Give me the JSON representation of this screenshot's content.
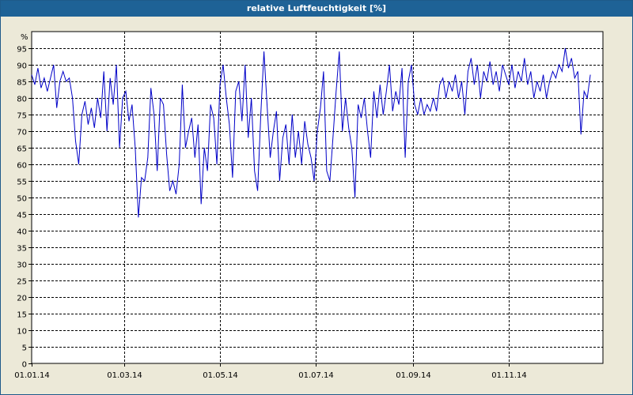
{
  "window": {
    "title": "relative Luftfeuchtigkeit [%]"
  },
  "chart_data": {
    "type": "line",
    "title": "relative Luftfeuchtigkeit [%]",
    "ylabel": "%",
    "xlabel": "",
    "ylim": [
      0,
      100
    ],
    "xlim": [
      "2014-01-01",
      "2014-12-31"
    ],
    "grid": true,
    "yticks": [
      0,
      5,
      10,
      15,
      20,
      25,
      30,
      35,
      40,
      45,
      50,
      55,
      60,
      65,
      70,
      75,
      80,
      85,
      90,
      95
    ],
    "xticks": [
      {
        "date": "2014-01-01",
        "label": "01.01.14"
      },
      {
        "date": "2014-03-01",
        "label": "01.03.14"
      },
      {
        "date": "2014-05-01",
        "label": "01.05.14"
      },
      {
        "date": "2014-07-01",
        "label": "01.07.14"
      },
      {
        "date": "2014-09-01",
        "label": "01.09.14"
      },
      {
        "date": "2014-11-01",
        "label": "01.11.14"
      }
    ],
    "series": [
      {
        "color": "#0000c8",
        "points": [
          [
            "2014-01-01",
            87
          ],
          [
            "2014-01-03",
            84
          ],
          [
            "2014-01-05",
            89
          ],
          [
            "2014-01-07",
            83
          ],
          [
            "2014-01-09",
            86
          ],
          [
            "2014-01-11",
            82
          ],
          [
            "2014-01-13",
            86
          ],
          [
            "2014-01-15",
            90
          ],
          [
            "2014-01-17",
            77
          ],
          [
            "2014-01-19",
            85
          ],
          [
            "2014-01-21",
            88
          ],
          [
            "2014-01-23",
            85
          ],
          [
            "2014-01-25",
            86
          ],
          [
            "2014-01-27",
            80
          ],
          [
            "2014-01-29",
            67
          ],
          [
            "2014-01-31",
            60
          ],
          [
            "2014-02-02",
            75
          ],
          [
            "2014-02-04",
            79
          ],
          [
            "2014-02-06",
            72
          ],
          [
            "2014-02-08",
            77
          ],
          [
            "2014-02-10",
            71
          ],
          [
            "2014-02-12",
            80
          ],
          [
            "2014-02-14",
            74
          ],
          [
            "2014-02-16",
            88
          ],
          [
            "2014-02-18",
            70
          ],
          [
            "2014-02-20",
            86
          ],
          [
            "2014-02-22",
            78
          ],
          [
            "2014-02-24",
            90
          ],
          [
            "2014-02-26",
            65
          ],
          [
            "2014-02-28",
            80
          ],
          [
            "2014-03-02",
            82
          ],
          [
            "2014-03-04",
            73
          ],
          [
            "2014-03-06",
            78
          ],
          [
            "2014-03-08",
            65
          ],
          [
            "2014-03-10",
            44
          ],
          [
            "2014-03-12",
            56
          ],
          [
            "2014-03-14",
            55
          ],
          [
            "2014-03-16",
            62
          ],
          [
            "2014-03-18",
            83
          ],
          [
            "2014-03-20",
            75
          ],
          [
            "2014-03-22",
            58
          ],
          [
            "2014-03-24",
            80
          ],
          [
            "2014-03-26",
            78
          ],
          [
            "2014-03-28",
            63
          ],
          [
            "2014-03-30",
            52
          ],
          [
            "2014-04-01",
            55
          ],
          [
            "2014-04-03",
            51
          ],
          [
            "2014-04-05",
            60
          ],
          [
            "2014-04-07",
            84
          ],
          [
            "2014-04-09",
            65
          ],
          [
            "2014-04-11",
            70
          ],
          [
            "2014-04-13",
            74
          ],
          [
            "2014-04-15",
            62
          ],
          [
            "2014-04-17",
            72
          ],
          [
            "2014-04-19",
            48
          ],
          [
            "2014-04-21",
            65
          ],
          [
            "2014-04-23",
            58
          ],
          [
            "2014-04-25",
            78
          ],
          [
            "2014-04-27",
            74
          ],
          [
            "2014-04-29",
            60
          ],
          [
            "2014-05-01",
            84
          ],
          [
            "2014-05-03",
            90
          ],
          [
            "2014-05-05",
            80
          ],
          [
            "2014-05-07",
            72
          ],
          [
            "2014-05-09",
            56
          ],
          [
            "2014-05-11",
            82
          ],
          [
            "2014-05-13",
            85
          ],
          [
            "2014-05-15",
            73
          ],
          [
            "2014-05-17",
            90
          ],
          [
            "2014-05-19",
            68
          ],
          [
            "2014-05-21",
            80
          ],
          [
            "2014-05-23",
            58
          ],
          [
            "2014-05-25",
            52
          ],
          [
            "2014-05-27",
            75
          ],
          [
            "2014-05-29",
            94
          ],
          [
            "2014-05-31",
            78
          ],
          [
            "2014-06-02",
            62
          ],
          [
            "2014-06-04",
            70
          ],
          [
            "2014-06-06",
            76
          ],
          [
            "2014-06-08",
            55
          ],
          [
            "2014-06-10",
            68
          ],
          [
            "2014-06-12",
            72
          ],
          [
            "2014-06-14",
            60
          ],
          [
            "2014-06-16",
            75
          ],
          [
            "2014-06-18",
            62
          ],
          [
            "2014-06-20",
            70
          ],
          [
            "2014-06-22",
            60
          ],
          [
            "2014-06-24",
            73
          ],
          [
            "2014-06-26",
            66
          ],
          [
            "2014-06-28",
            62
          ],
          [
            "2014-06-30",
            55
          ],
          [
            "2014-07-02",
            70
          ],
          [
            "2014-07-04",
            77
          ],
          [
            "2014-07-06",
            88
          ],
          [
            "2014-07-08",
            58
          ],
          [
            "2014-07-10",
            55
          ],
          [
            "2014-07-12",
            68
          ],
          [
            "2014-07-14",
            82
          ],
          [
            "2014-07-16",
            94
          ],
          [
            "2014-07-18",
            70
          ],
          [
            "2014-07-20",
            80
          ],
          [
            "2014-07-22",
            71
          ],
          [
            "2014-07-24",
            65
          ],
          [
            "2014-07-26",
            50
          ],
          [
            "2014-07-28",
            78
          ],
          [
            "2014-07-30",
            74
          ],
          [
            "2014-08-01",
            80
          ],
          [
            "2014-08-03",
            70
          ],
          [
            "2014-08-05",
            62
          ],
          [
            "2014-08-07",
            82
          ],
          [
            "2014-08-09",
            74
          ],
          [
            "2014-08-11",
            84
          ],
          [
            "2014-08-13",
            75
          ],
          [
            "2014-08-15",
            82
          ],
          [
            "2014-08-17",
            90
          ],
          [
            "2014-08-19",
            76
          ],
          [
            "2014-08-21",
            82
          ],
          [
            "2014-08-23",
            78
          ],
          [
            "2014-08-25",
            89
          ],
          [
            "2014-08-27",
            62
          ],
          [
            "2014-08-29",
            85
          ],
          [
            "2014-08-31",
            90
          ],
          [
            "2014-09-02",
            78
          ],
          [
            "2014-09-04",
            75
          ],
          [
            "2014-09-06",
            80
          ],
          [
            "2014-09-08",
            75
          ],
          [
            "2014-09-10",
            78
          ],
          [
            "2014-09-12",
            76
          ],
          [
            "2014-09-14",
            80
          ],
          [
            "2014-09-16",
            76
          ],
          [
            "2014-09-18",
            84
          ],
          [
            "2014-09-20",
            86
          ],
          [
            "2014-09-22",
            80
          ],
          [
            "2014-09-24",
            85
          ],
          [
            "2014-09-26",
            82
          ],
          [
            "2014-09-28",
            87
          ],
          [
            "2014-09-30",
            80
          ],
          [
            "2014-10-02",
            85
          ],
          [
            "2014-10-04",
            75
          ],
          [
            "2014-10-06",
            88
          ],
          [
            "2014-10-08",
            92
          ],
          [
            "2014-10-10",
            84
          ],
          [
            "2014-10-12",
            90
          ],
          [
            "2014-10-14",
            80
          ],
          [
            "2014-10-16",
            88
          ],
          [
            "2014-10-18",
            85
          ],
          [
            "2014-10-20",
            91
          ],
          [
            "2014-10-22",
            84
          ],
          [
            "2014-10-24",
            88
          ],
          [
            "2014-10-26",
            82
          ],
          [
            "2014-10-28",
            90
          ],
          [
            "2014-10-30",
            87
          ],
          [
            "2014-11-01",
            84
          ],
          [
            "2014-11-03",
            90
          ],
          [
            "2014-11-05",
            83
          ],
          [
            "2014-11-07",
            88
          ],
          [
            "2014-11-09",
            85
          ],
          [
            "2014-11-11",
            92
          ],
          [
            "2014-11-13",
            84
          ],
          [
            "2014-11-15",
            88
          ],
          [
            "2014-11-17",
            80
          ],
          [
            "2014-11-19",
            85
          ],
          [
            "2014-11-21",
            82
          ],
          [
            "2014-11-23",
            87
          ],
          [
            "2014-11-25",
            80
          ],
          [
            "2014-11-27",
            85
          ],
          [
            "2014-11-29",
            88
          ],
          [
            "2014-12-01",
            86
          ],
          [
            "2014-12-03",
            90
          ],
          [
            "2014-12-05",
            88
          ],
          [
            "2014-12-07",
            95
          ],
          [
            "2014-12-09",
            89
          ],
          [
            "2014-12-11",
            92
          ],
          [
            "2014-12-13",
            86
          ],
          [
            "2014-12-15",
            88
          ],
          [
            "2014-12-17",
            69
          ],
          [
            "2014-12-19",
            82
          ],
          [
            "2014-12-21",
            80
          ],
          [
            "2014-12-23",
            87
          ]
        ]
      }
    ]
  }
}
